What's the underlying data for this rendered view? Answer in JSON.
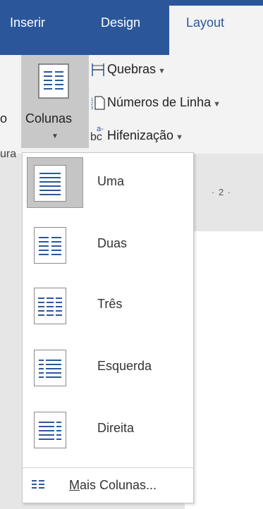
{
  "tabs": [
    "Inserir",
    "Design",
    "Layout"
  ],
  "ribbon": {
    "left_partial_label": "o",
    "columns_label": "Colunas",
    "group_partial_label": "ura",
    "breaks_label": "Quebras",
    "line_numbers_label": "Números de Linha",
    "hyphenation_label": "Hifenização",
    "hyphenation_icon_text": "bc",
    "hyphenation_icon_sup": "a-"
  },
  "ruler": {
    "text": "· 2 ·"
  },
  "columns_menu": {
    "items": [
      {
        "label": "Uma",
        "icon": "one-column-icon",
        "selected": true
      },
      {
        "label": "Duas",
        "icon": "two-columns-icon",
        "selected": false
      },
      {
        "label": "Três",
        "icon": "three-columns-icon",
        "selected": false
      },
      {
        "label": "Esquerda",
        "icon": "left-column-icon",
        "selected": false
      },
      {
        "label": "Direita",
        "icon": "right-column-icon",
        "selected": false
      }
    ],
    "more_label_accel": "M",
    "more_label_rest": "ais Colunas..."
  },
  "colors": {
    "tab_bar": "#2b579a",
    "ribbon": "#f3f3f3",
    "icon_blue": "#2b579a",
    "selected_bg": "#c5c5c5"
  }
}
